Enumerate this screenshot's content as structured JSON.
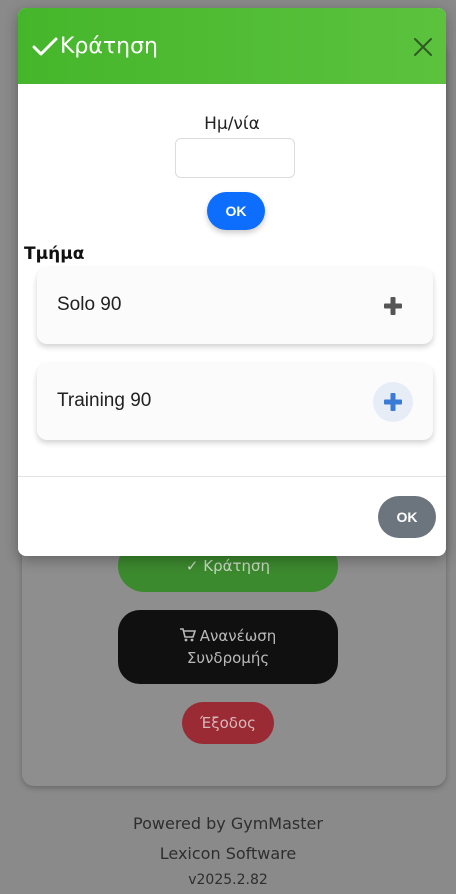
{
  "background": {
    "reserve_button": "✓ Κράτηση",
    "renew_line1": "Ανανέωση",
    "renew_line2": "Συνδρομής",
    "exit_button": "Έξοδος",
    "footer": {
      "powered": "Powered by GymMaster",
      "company": "Lexicon Software",
      "version": "v2025.2.82"
    }
  },
  "modal": {
    "title": "Κράτηση",
    "date_label": "Ημ/νία",
    "date_value": "",
    "date_ok": "OK",
    "section_label": "Τμήμα",
    "classes": [
      {
        "name": "Solo 90",
        "icon": "plus-icon",
        "icon_color": "#555555"
      },
      {
        "name": "Training 90",
        "icon": "plus-icon",
        "icon_color": "#3a7bd5"
      }
    ],
    "footer_ok": "OK"
  },
  "colors": {
    "header_green": "#4cba33",
    "primary_blue": "#0d6efd",
    "secondary_gray": "#6c757d"
  }
}
